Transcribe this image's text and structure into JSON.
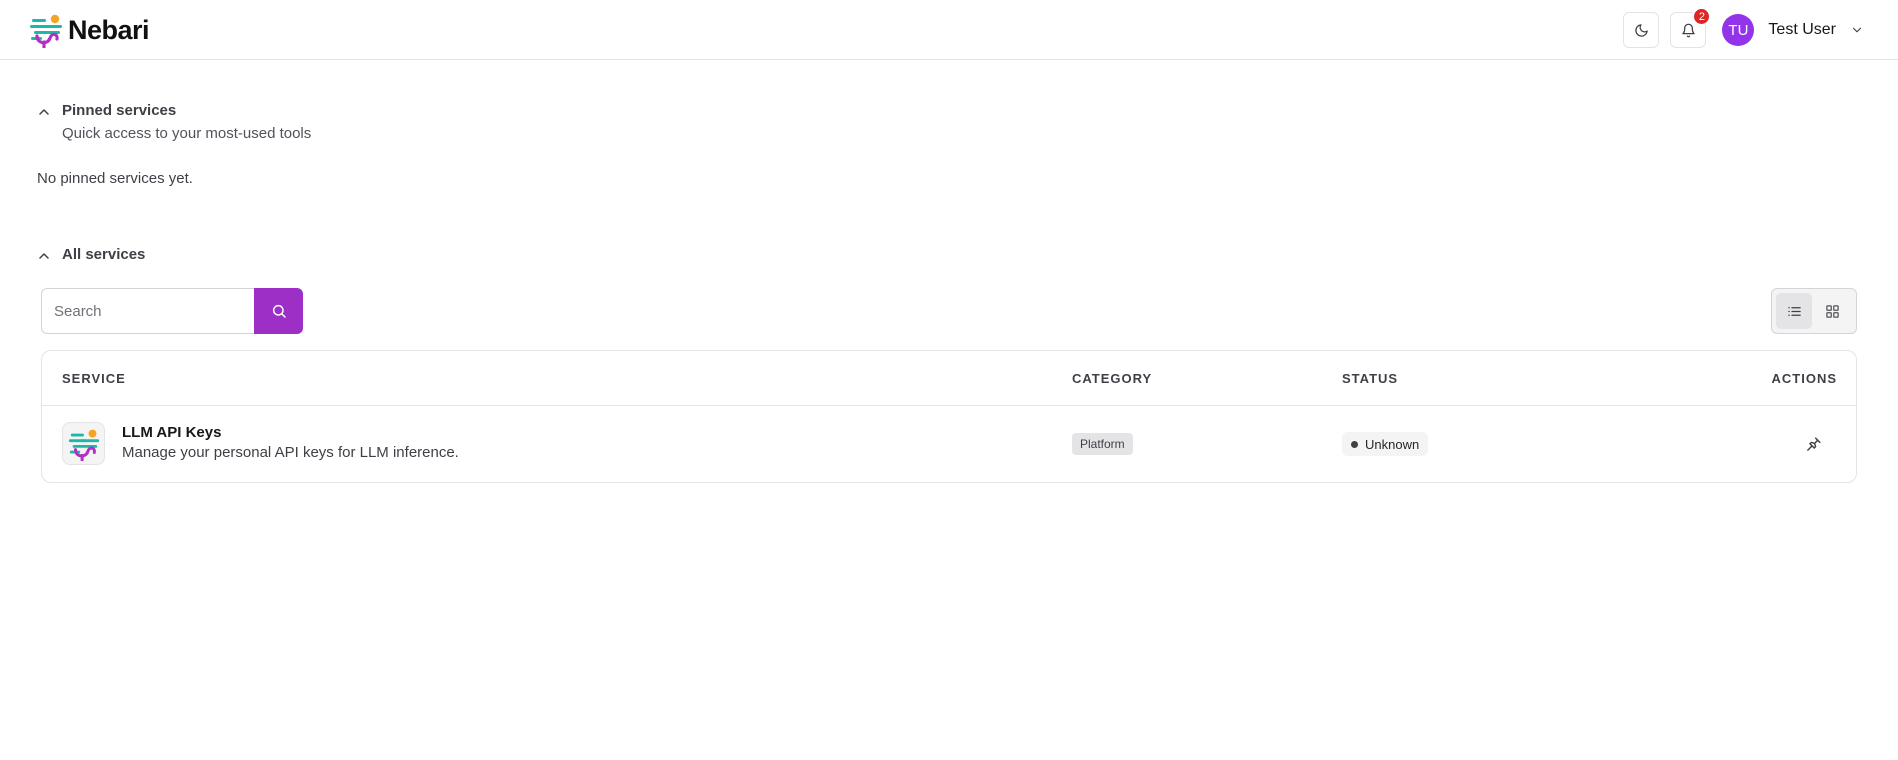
{
  "header": {
    "brand": "Nebari",
    "notifications_count": "2",
    "user": {
      "initials": "TU",
      "name": "Test User"
    },
    "icons": {
      "theme": "moon-icon",
      "notifications": "bell-icon",
      "user_menu": "chevron-down-icon"
    }
  },
  "pinned": {
    "title": "Pinned services",
    "subtitle": "Quick access to your most-used tools",
    "empty_message": "No pinned services yet."
  },
  "all_services": {
    "title": "All services",
    "search": {
      "placeholder": "Search",
      "value": ""
    }
  },
  "table": {
    "columns": [
      "SERVICE",
      "CATEGORY",
      "STATUS",
      "ACTIONS"
    ],
    "rows": [
      {
        "name": "LLM API Keys",
        "description": "Manage your personal API keys for LLM inference.",
        "category": "Platform",
        "status": "Unknown"
      }
    ]
  },
  "colors": {
    "accent": "#9d2fc6",
    "avatar": "#9333ea",
    "badge": "#dc2626",
    "logo_teal": "#1bb9a6",
    "logo_orange": "#f5a523",
    "logo_magenta": "#b32fc5"
  }
}
